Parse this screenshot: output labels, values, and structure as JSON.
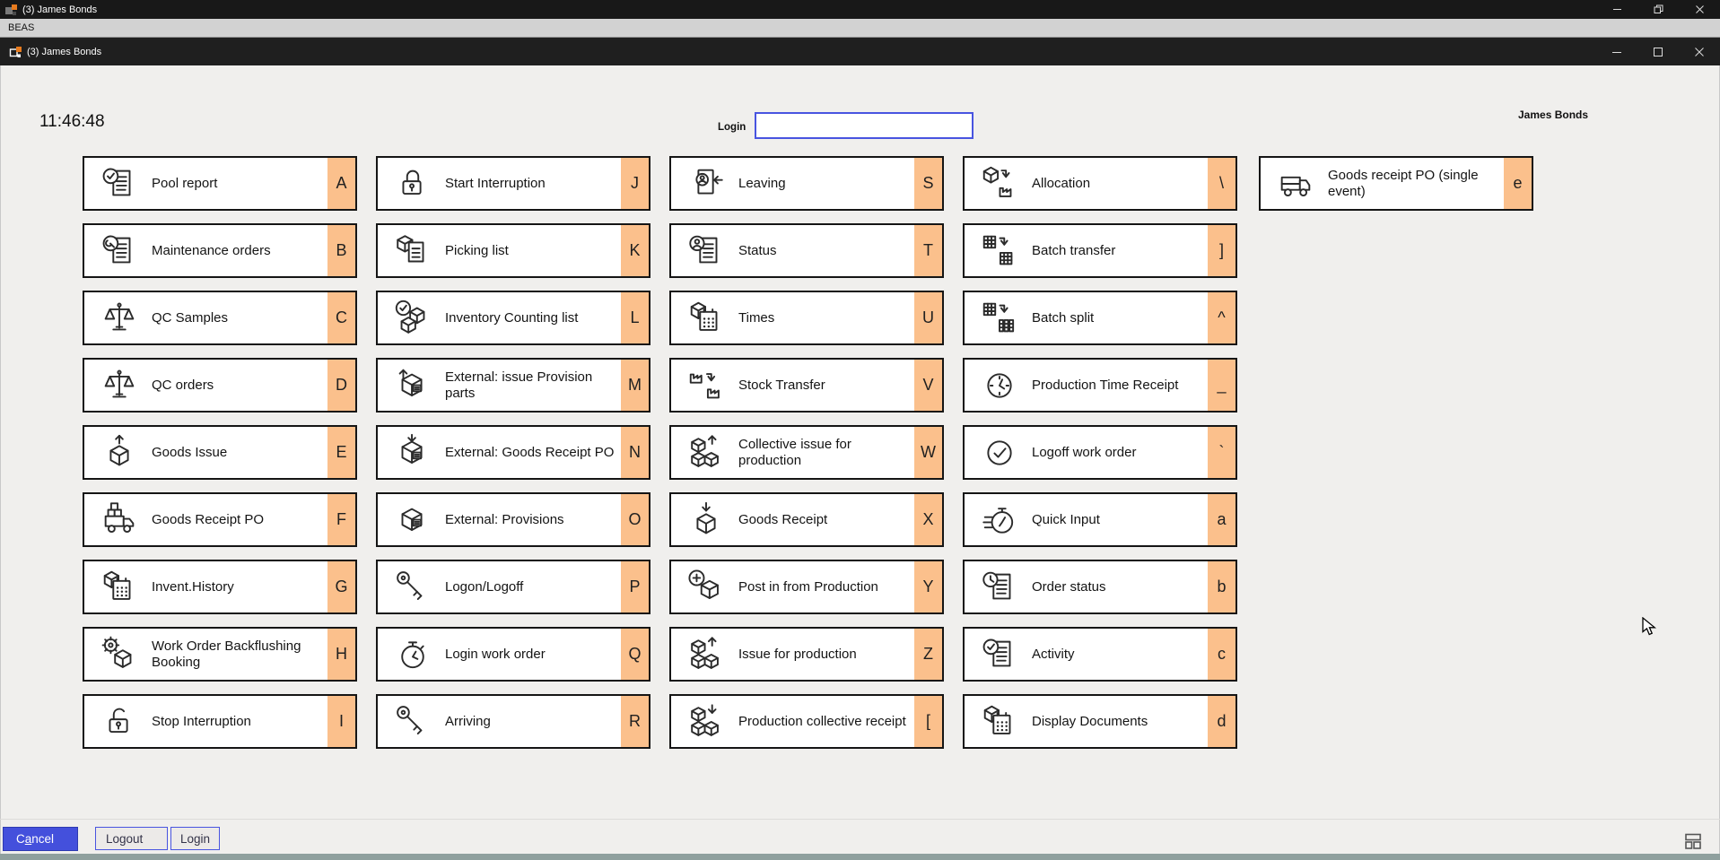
{
  "window": {
    "outer_title": "(3) James Bonds",
    "menu_label": "BEAS",
    "inner_title": "(3) James Bonds"
  },
  "header": {
    "clock": "11:46:48",
    "login_label": "Login",
    "login_value": "",
    "user_name": "James Bonds"
  },
  "grid": {
    "columns": [
      [
        {
          "label": "Pool report",
          "shortcut": "A",
          "icon": "doc-check"
        },
        {
          "label": "Maintenance orders",
          "shortcut": "B",
          "icon": "doc-wrench"
        },
        {
          "label": "QC Samples",
          "shortcut": "C",
          "icon": "scale"
        },
        {
          "label": "QC orders",
          "shortcut": "D",
          "icon": "scale"
        },
        {
          "label": "Goods Issue",
          "shortcut": "E",
          "icon": "box-arrow-up"
        },
        {
          "label": "Goods Receipt PO",
          "shortcut": "F",
          "icon": "truck-boxes"
        },
        {
          "label": "Invent.History",
          "shortcut": "G",
          "icon": "box-calendar"
        },
        {
          "label": "Work Order Backflushing Booking",
          "shortcut": "H",
          "icon": "box-gear"
        },
        {
          "label": "Stop Interruption",
          "shortcut": "I",
          "icon": "padlock-open"
        }
      ],
      [
        {
          "label": "Start Interruption",
          "shortcut": "J",
          "icon": "padlock"
        },
        {
          "label": "Picking list",
          "shortcut": "K",
          "icon": "box-doc"
        },
        {
          "label": "Inventory Counting list",
          "shortcut": "L",
          "icon": "boxes-check"
        },
        {
          "label": "External: issue Provision parts",
          "shortcut": "M",
          "icon": "box-up-label"
        },
        {
          "label": "External: Goods Receipt PO",
          "shortcut": "N",
          "icon": "box-down-label"
        },
        {
          "label": "External: Provisions",
          "shortcut": "O",
          "icon": "box-label"
        },
        {
          "label": "Logon/Logoff",
          "shortcut": "P",
          "icon": "key"
        },
        {
          "label": "Login work order",
          "shortcut": "Q",
          "icon": "stopwatch"
        },
        {
          "label": "Arriving",
          "shortcut": "R",
          "icon": "key"
        }
      ],
      [
        {
          "label": "Leaving",
          "shortcut": "S",
          "icon": "person-out"
        },
        {
          "label": "Status",
          "shortcut": "T",
          "icon": "person-doc"
        },
        {
          "label": "Times",
          "shortcut": "U",
          "icon": "box-calendar"
        },
        {
          "label": "Stock Transfer",
          "shortcut": "V",
          "icon": "factory-transfer"
        },
        {
          "label": "Collective issue for production",
          "shortcut": "W",
          "icon": "boxes-up"
        },
        {
          "label": "Goods Receipt",
          "shortcut": "X",
          "icon": "box-arrow-down"
        },
        {
          "label": "Post in from Production",
          "shortcut": "Y",
          "icon": "box-plus"
        },
        {
          "label": "Issue for production",
          "shortcut": "Z",
          "icon": "boxes-up"
        },
        {
          "label": "Production collective receipt",
          "shortcut": "[",
          "icon": "boxes-down"
        }
      ],
      [
        {
          "label": "Allocation",
          "shortcut": "\\",
          "icon": "box-factory"
        },
        {
          "label": "Batch transfer",
          "shortcut": "]",
          "icon": "grid-transfer"
        },
        {
          "label": "Batch split",
          "shortcut": "^",
          "icon": "grid-split"
        },
        {
          "label": "Production Time Receipt",
          "shortcut": "_",
          "icon": "clock"
        },
        {
          "label": "Logoff work order",
          "shortcut": "`",
          "icon": "clock-check"
        },
        {
          "label": "Quick Input",
          "shortcut": "a",
          "icon": "stopwatch-fast"
        },
        {
          "label": "Order status",
          "shortcut": "b",
          "icon": "doc-clock"
        },
        {
          "label": "Activity",
          "shortcut": "c",
          "icon": "doc-check"
        },
        {
          "label": "Display Documents",
          "shortcut": "d",
          "icon": "box-calendar"
        }
      ],
      [
        {
          "label": "Goods receipt PO  (single event)",
          "shortcut": "e",
          "icon": "truck"
        }
      ]
    ]
  },
  "footer": {
    "cancel_label": "Cancel",
    "logout_label": "Logout",
    "login_label": "Login"
  },
  "colors": {
    "titlebar_bg": "#181818",
    "inner_titlebar_bg": "#1f1f1f",
    "menubar_bg": "#d2d2d2",
    "content_bg": "#f0efed",
    "button_border": "#151515",
    "badge_bg": "#fbc08c",
    "accent_blue": "#4854e0",
    "cancel_bg": "#4450dc",
    "status_strip": "#8fa09e",
    "logo_orange": "#e87b1e"
  }
}
